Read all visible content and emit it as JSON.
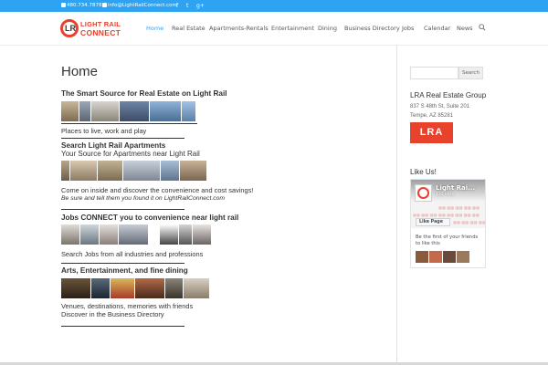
{
  "topbar": {
    "phone": "480.734.7878",
    "email": "info@LightRailConnect.com",
    "social": [
      "f",
      "t",
      "g+"
    ],
    "accent_color": "#2ea3f2"
  },
  "header": {
    "logo": {
      "mark": "LR",
      "line1": "LIGHT RAIL",
      "line2": "CONNECT"
    },
    "nav": [
      "Home",
      "Real Estate",
      "Apartments-Rentals",
      "Entertainment",
      "Dining",
      "Business Directory",
      "Jobs",
      "Calendar",
      "News"
    ],
    "active_nav": "Home",
    "search_icon": "search-icon"
  },
  "main": {
    "title": "Home",
    "sections": [
      {
        "heading": "The Smart Source for Real Estate on Light Rail",
        "caption": "Places to live, work and play"
      },
      {
        "heading": "Search Light Rail Apartments",
        "subheading": "Your Source for Apartments near Light Rail",
        "caption": "Come on inside and discover the convenience and cost savings!",
        "note": "Be sure and tell them you found it on LightRailConnect.com"
      },
      {
        "heading": "Jobs CONNECT you to convenience near light rail",
        "caption": "Search Jobs from all industries and professions"
      },
      {
        "heading": "Arts, Entertainment, and fine dining",
        "caption_line1": "Venues, destinations, memories with friends",
        "caption_line2": "Discover in the  Business Directory"
      }
    ]
  },
  "sidebar": {
    "search_button": "Search",
    "group": {
      "title": "LRA Real Estate Group",
      "address1": "837 S 48th St,  Suite 201",
      "address2": "Tempe, AZ     85281",
      "logo_text": "LRA"
    },
    "like_title": "Like Us!",
    "facebook": {
      "page_name": "Light Rai...",
      "likes": "132 likes",
      "like_button": "Like Page",
      "text": "Be the first of your friends to like this"
    },
    "brand_color": "#e8412c"
  }
}
